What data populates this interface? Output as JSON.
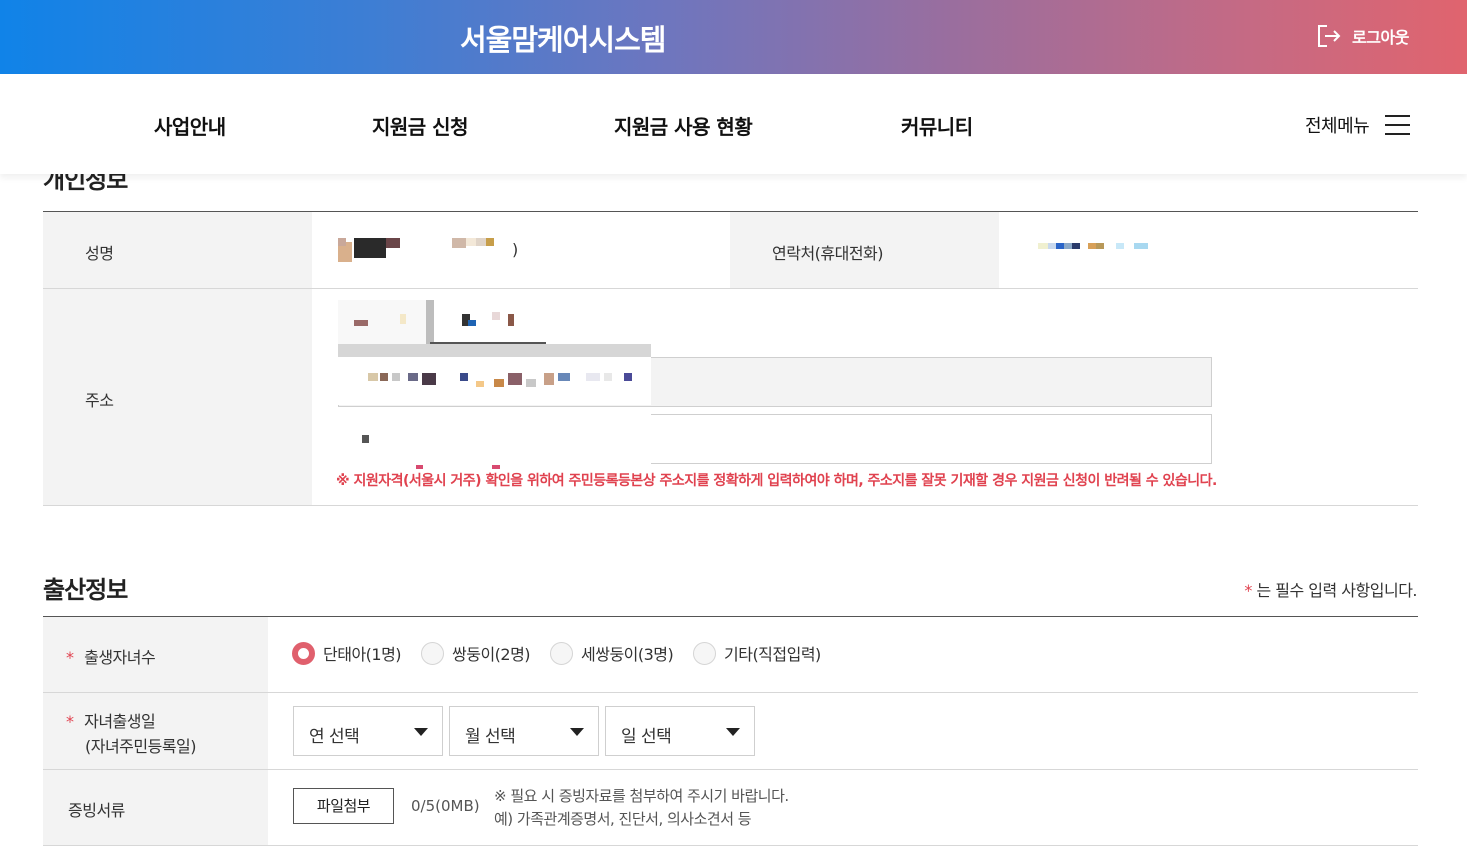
{
  "header": {
    "title": "서울맘케어시스템",
    "logout_label": "로그아웃"
  },
  "nav": {
    "items": [
      {
        "label": "사업안내"
      },
      {
        "label": "지원금 신청"
      },
      {
        "label": "지원금 사용 현황"
      },
      {
        "label": "커뮤니티"
      }
    ],
    "all_menu_label": "전체메뉴"
  },
  "personal": {
    "section_title": "개인정보",
    "name_label": "성명",
    "name_suffix": ")",
    "contact_label": "연락처(휴대전화)",
    "address_label": "주소",
    "address_notice": "※ 지원자격(서울시 거주) 확인을 위하여 주민등록등본상 주소지를 정확하게 입력하여야 하며, 주소지를 잘못 기재할 경우 지원금 신청이 반려될 수 있습니다."
  },
  "birth": {
    "section_title": "출산정보",
    "required_star": "*",
    "required_note": "는 필수 입력 사항입니다.",
    "children_count_label": "출생자녀수",
    "children_options": [
      {
        "label": "단태아(1명)",
        "checked": true
      },
      {
        "label": "쌍둥이(2명)",
        "checked": false
      },
      {
        "label": "세쌍둥이(3명)",
        "checked": false
      },
      {
        "label": "기타(직접입력)",
        "checked": false
      }
    ],
    "birthdate_label_1": "자녀출생일",
    "birthdate_label_2": "(자녀주민등록일)",
    "year_select": "연 선택",
    "month_select": "월 선택",
    "day_select": "일 선택",
    "proof_label": "증빙서류",
    "file_button": "파일첨부",
    "file_count": "0/5(0MB)",
    "file_note_1": "※ 필요 시 증빙자료를 첨부하여 주시기 바랍니다.",
    "file_note_2": "예) 가족관계증명서, 진단서, 의사소견서 등"
  },
  "colors": {
    "accent_red": "#e0424f",
    "gradient_start": "#1083e8",
    "gradient_end": "#e0646e"
  }
}
